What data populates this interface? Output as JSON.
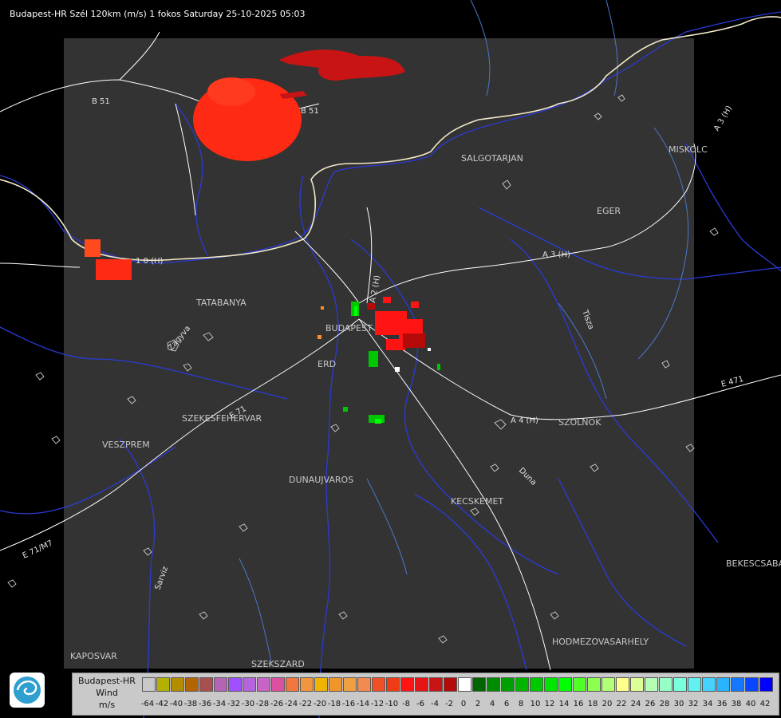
{
  "header": {
    "title": "Budapest-HR Szél 120km (m/s) 1 fokos Saturday 25-10-2025 05:03"
  },
  "cities": [
    {
      "name": "SALGOTARJAN"
    },
    {
      "name": "MISKOLC"
    },
    {
      "name": "EGER"
    },
    {
      "name": "TATABANYA"
    },
    {
      "name": "BUDAPEST"
    },
    {
      "name": "ERD"
    },
    {
      "name": "SZEKESFEHERVAR"
    },
    {
      "name": "VESZPREM"
    },
    {
      "name": "DUNAUJVAROS"
    },
    {
      "name": "KECSKEMET"
    },
    {
      "name": "SZOLNOK"
    },
    {
      "name": "BEKESCSABA"
    },
    {
      "name": "HODMEZOVASARHELY"
    },
    {
      "name": "KAPOSVAR"
    },
    {
      "name": "SZEKSZARD"
    }
  ],
  "roads": [
    {
      "name": "B 51"
    },
    {
      "name": "B 51"
    },
    {
      "name": "A 3 (H)"
    },
    {
      "name": "A 4 (H)"
    },
    {
      "name": "A 2 (H)"
    },
    {
      "name": "E 71"
    },
    {
      "name": "E 71/M7"
    },
    {
      "name": "E 471"
    },
    {
      "name": "A 3 (H)"
    },
    {
      "name": "1 0 (H)"
    },
    {
      "name": "Tisza"
    },
    {
      "name": "Duna"
    },
    {
      "name": "Sarviz"
    },
    {
      "name": "Zagyva"
    }
  ],
  "legend": {
    "line1": "Budapest-HR",
    "line2": "Wind",
    "line3": "m/s",
    "colors": [
      "#c8c8c8",
      "#b4b000",
      "#b48c00",
      "#b46400",
      "#a85050",
      "#b464b4",
      "#a050ff",
      "#b464dc",
      "#c864c8",
      "#dc50a0",
      "#f07840",
      "#f09640",
      "#f0b400",
      "#f09628",
      "#f0a040",
      "#f08c50",
      "#f05028",
      "#f03c14",
      "#ff1414",
      "#e61414",
      "#c81414",
      "#b40a0a",
      "#ffffff",
      "#006400",
      "#008c00",
      "#00a000",
      "#00b400",
      "#00c800",
      "#00e600",
      "#00ff00",
      "#50ff28",
      "#8cff50",
      "#b4ff78",
      "#ffff8c",
      "#dcff96",
      "#b4ffb4",
      "#96ffc8",
      "#78ffdc",
      "#64f0f0",
      "#46d2ff",
      "#28b4ff",
      "#1478ff",
      "#0a46ff",
      "#0000ff"
    ],
    "ticks": [
      "-64",
      "-42",
      "-40",
      "-38",
      "-36",
      "-34",
      "-32",
      "-30",
      "-28",
      "-26",
      "-24",
      "-22",
      "-20",
      "-18",
      "-16",
      "-14",
      "-12",
      "-10",
      "-8",
      "-6",
      "-4",
      "-2",
      "0",
      "2",
      "4",
      "6",
      "8",
      "10",
      "12",
      "14",
      "16",
      "18",
      "20",
      "22",
      "24",
      "26",
      "28",
      "30",
      "32",
      "34",
      "36",
      "38",
      "40",
      "42"
    ]
  }
}
